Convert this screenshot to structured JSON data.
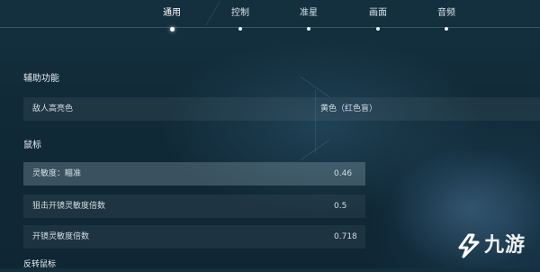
{
  "tabs": [
    {
      "label": "通用",
      "active": true
    },
    {
      "label": "控制",
      "active": false
    },
    {
      "label": "准星",
      "active": false
    },
    {
      "label": "画面",
      "active": false
    },
    {
      "label": "音频",
      "active": false
    }
  ],
  "accessibility": {
    "title": "辅助功能",
    "enemy_highlight": {
      "label": "敌人高亮色",
      "value": "黄色（红色盲）"
    }
  },
  "mouse": {
    "title": "鼠标",
    "sensitivity": {
      "label": "灵敏度：瞄准",
      "value": "0.46"
    },
    "scoped_multiplier": {
      "label": "狙击开镜灵敏度倍数",
      "value": "0.5"
    },
    "ads_multiplier": {
      "label": "开镜灵敏度倍数",
      "value": "0.718"
    },
    "invert_label": "反转鼠标"
  },
  "watermark": {
    "text": "九游",
    "icon": "jiuyou-logo-icon"
  }
}
